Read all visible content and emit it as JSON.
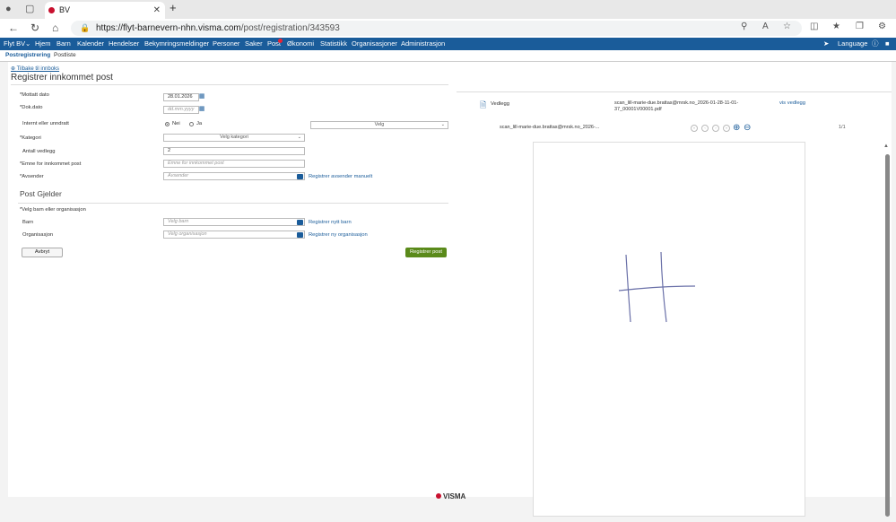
{
  "browser": {
    "tab_title": "BV",
    "url_host": "https://flyt-barnevern-nhn.visma.com",
    "url_path": "/post/registration/343593"
  },
  "menu": {
    "items": [
      "Flyt BV",
      "Hjem",
      "Barn",
      "Kalender",
      "Hendelser",
      "Bekymringsmeldinger",
      "Personer",
      "Saker",
      "Post",
      "Økonomi",
      "Statistikk",
      "Organisasjoner",
      "Administrasjon"
    ],
    "language": "Language"
  },
  "subnav": {
    "active": "Postregistrering",
    "other": "Postliste"
  },
  "page": {
    "back": "Tilbake til innboks",
    "title": "Registrer innkommet post"
  },
  "form": {
    "mottatt_label": "*Mottatt dato",
    "mottatt_value": "28.01.2026",
    "dok_label": "*Dok.dato",
    "dok_placeholder": "dd.mm.yyyy",
    "internt_label": "Internt eller unndratt",
    "nei": "Nei",
    "ja": "Ja",
    "velg": "Velg",
    "kategori_label": "*Kategori",
    "kategori_value": "Velg kategori",
    "antall_label": "Antall vedlegg",
    "antall_value": "2",
    "emne_label": "*Emne for innkommet post",
    "emne_placeholder": "Emne for innkommet post",
    "avsender_label": "*Avsender",
    "avsender_placeholder": "Avsender",
    "avsender_link": "Registrer avsender manuelt",
    "section": "Post Gjelder",
    "velg_label": "*Velg barn eller organisasjon",
    "barn_label": "Barn",
    "barn_placeholder": "Velg barn",
    "barn_link": "Registrer nytt barn",
    "org_label": "Organisasjon",
    "org_placeholder": "Velg organisasjon",
    "org_link": "Registrer ny organisasjon",
    "cancel": "Avbryt",
    "submit": "Registrer post"
  },
  "attachment": {
    "label": "Vedlegg",
    "file_line1": "scan_lill-marie-due.brattas@mrsk.no_2026-01-28-11-01-",
    "file_line2": "37_00001V00001.pdf",
    "link": "vis vedlegg",
    "viewer_file": "scan_lill-marie-due.brattas@mrsk.no_2026-...",
    "page": "1/1"
  },
  "footer": {
    "brand": "VISMA"
  }
}
